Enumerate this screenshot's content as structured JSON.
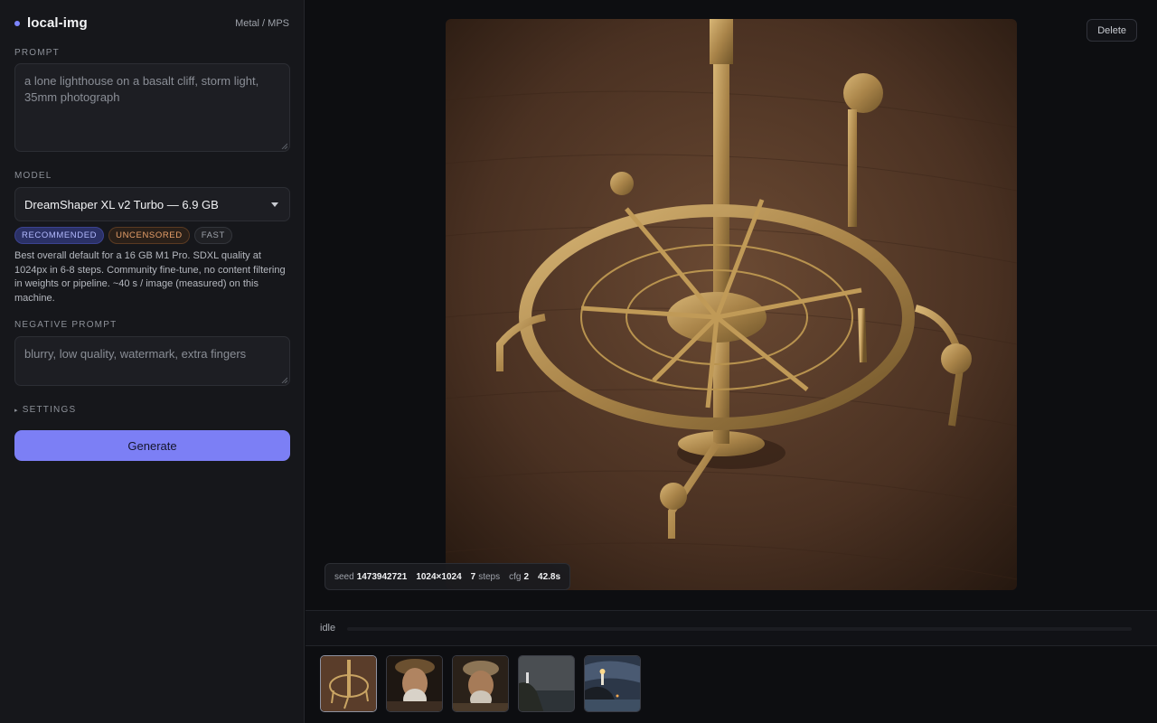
{
  "app": {
    "name": "local-img",
    "backend": "Metal / MPS"
  },
  "prompt": {
    "label": "PROMPT",
    "value": "a lone lighthouse on a basalt cliff, storm light, 35mm photograph"
  },
  "model": {
    "label": "MODEL",
    "selected": "DreamShaper XL v2 Turbo — 6.9 GB",
    "badges": [
      "RECOMMENDED",
      "UNCENSORED",
      "FAST"
    ],
    "description": "Best overall default for a 16 GB M1 Pro. SDXL quality at 1024px in 6-8 steps. Community fine-tune, no content filtering in weights or pipeline. ~40 s / image (measured) on this machine."
  },
  "negative_prompt": {
    "label": "NEGATIVE PROMPT",
    "value": "blurry, low quality, watermark, extra fingers"
  },
  "settings": {
    "label": "SETTINGS"
  },
  "generate": {
    "label": "Generate"
  },
  "viewer": {
    "delete_label": "Delete",
    "meta": {
      "seed_label": "seed",
      "seed": "1473942721",
      "size": "1024×1024",
      "steps": "7",
      "steps_label": "steps",
      "cfg_label": "cfg",
      "cfg": "2",
      "time": "42.8s"
    }
  },
  "status": {
    "text": "idle",
    "progress": 0
  },
  "history": [
    {
      "subject": "brass-orrery"
    },
    {
      "subject": "old-man-portrait"
    },
    {
      "subject": "old-man-cap-portrait"
    },
    {
      "subject": "lighthouse-cliff-day"
    },
    {
      "subject": "lighthouse-cliff-night"
    }
  ],
  "colors": {
    "accent": "#7c7ff5",
    "background": "#0d0e11",
    "sidebar": "#16171b"
  }
}
